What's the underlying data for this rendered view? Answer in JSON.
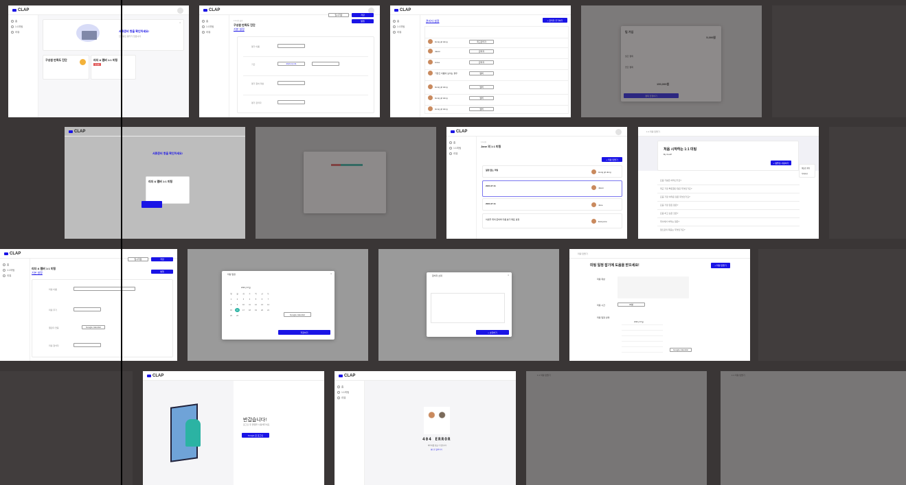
{
  "brand": {
    "logo_text": "CLAP",
    "accent": "#1a14e6",
    "teal": "#2bb3a3"
  },
  "sidebar": {
    "items": [
      {
        "label": "홈"
      },
      {
        "label": "1:1미팅"
      },
      {
        "label": "리뷰"
      }
    ]
  },
  "home": {
    "banner_title": "서류준비 항을 확인하세요!",
    "banner_sub": "진행중인 평가가 있습니다",
    "card1_title": "구성원 만족도 진단",
    "card2_title": "리더 & 멤버 1:1 미팅",
    "card2_badge": "진행중"
  },
  "setup": {
    "crumb": "1:1미팅 설정",
    "title": "구성원 만족도 진단",
    "subtitle": "기본 설정",
    "btn_temp": "임시저장",
    "btn_save": "저장",
    "btn_publish": "발행",
    "row1": "평가 이름",
    "row2": "기간",
    "row3": "평가 참여 대상",
    "row4": "평가 관리자",
    "value2": "2021.12.31"
  },
  "members": {
    "title": "관리자 설정",
    "add_btn": "+ 관리자 추가하기",
    "rows": [
      {
        "name": "Hong gil dong",
        "role": "최고관리자"
      },
      {
        "name": "Jason",
        "role": "관리자"
      },
      {
        "name": "Anna",
        "role": "관리자"
      },
      {
        "name": "가장긴 이름이 보이는 경우",
        "role": "멤버"
      },
      {
        "name": "Hong gil dong",
        "role": "멤버"
      },
      {
        "name": "Hong gil dong",
        "role": "멤버"
      },
      {
        "name": "Hong gil dong",
        "role": "멤버"
      }
    ]
  },
  "pricing": {
    "title": "팀 가입",
    "price": "5,000원",
    "plan1": "월간 결제",
    "plan2": "연간 결제",
    "total": "150,000원",
    "cta": "결제 진행하기"
  },
  "meeting": {
    "crumb": "1:1미팅",
    "title": "Jane 의 1:1 미팅",
    "new_btn": "+ 미팅 만들기",
    "items": [
      {
        "title": "일정 없는 미팅",
        "person": "Hong gil dong"
      },
      {
        "title": "2021.07.11",
        "person": "Jason"
      },
      {
        "title": "2021.07.11",
        "person": "Jane"
      },
      {
        "title": "이번주 회의 준비와 다음 분기 목표 설정",
        "person": "Everyone"
      }
    ]
  },
  "first": {
    "title": "처음 시작하는 1:1 미팅",
    "by": "By CLAP",
    "cta": "+ 템플릿 사용하기",
    "menu1": "템플릿 편집",
    "menu2": "삭제하기",
    "questions": [
      "요즘 기분은 어떠신가요?",
      "최근 가장 뿌듯했던 일은 무엇인가요?",
      "요즘 가장 어려운 점은 무엇인가요?",
      "요즘 가장 힘든 점은?",
      "요즘 하고 싶은 것은?",
      "회사에서 바라는 점은?",
      "앞으로의 목표는 무엇인가요?"
    ]
  },
  "meeting_setup": {
    "title": "리더 & 멤버 1:1 미팅",
    "subtitle": "기본 설정",
    "row1": "미팅 이름",
    "row2": "미팅 주기",
    "row3": "캘린더 연동",
    "row4": "미팅 참석자",
    "calendar_btn": "Google calendar"
  },
  "schedule_modal": {
    "title": "미팅 일정",
    "month": "2021년 07월",
    "days": [
      "일",
      "월",
      "화",
      "수",
      "목",
      "금",
      "토"
    ],
    "dates": [
      "",
      "",
      "",
      "1",
      "2",
      "3",
      "4",
      "5",
      "6",
      "7",
      "8",
      "9",
      "10",
      "11",
      "12",
      "13",
      "14",
      "15",
      "16",
      "17",
      "18",
      "19",
      "20",
      "21",
      "22",
      "23",
      "24",
      "25",
      "26",
      "27",
      "28",
      "29",
      "30",
      "31",
      ""
    ],
    "selected": "15",
    "google": "Google calendar",
    "cta": "저장하기"
  },
  "invite_modal": {
    "title": "참석자 초대",
    "cta": "+ 초대하기"
  },
  "wizard": {
    "crumb": "미팅 만들기",
    "title": "미팅 일정 잡기에 도움을 받으세요!",
    "cta": "+ 미팅 만들기",
    "row1": "미팅 대상",
    "row2": "미팅 시간",
    "row3": "미팅 일정 선택",
    "month": "2021년 07월",
    "time_value": "30분"
  },
  "welcome": {
    "title": "반갑습니다!",
    "sub": "로그인 후 클랩을 사용해주세요",
    "cta": "Google 로 로그인"
  },
  "notfound": {
    "code": "404 ERROR",
    "msg": "페이지를 찾을 수 없습니다",
    "link": "홈으로 돌아가기"
  },
  "drawer": {
    "title": "1:1 미팅 만들기"
  }
}
